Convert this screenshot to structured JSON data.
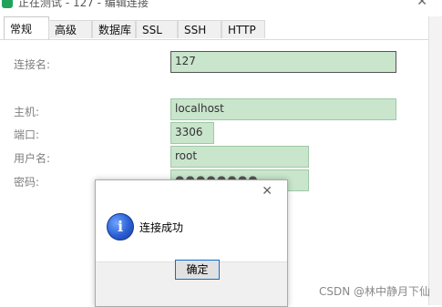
{
  "window": {
    "title": "正在测试 - 127 - 编辑连接"
  },
  "tabs": [
    {
      "label": "常规",
      "active": true
    },
    {
      "label": "高级",
      "active": false
    },
    {
      "label": "数据库",
      "active": false
    },
    {
      "label": "SSL",
      "active": false
    },
    {
      "label": "SSH",
      "active": false
    },
    {
      "label": "HTTP",
      "active": false
    }
  ],
  "form": {
    "connection_name_label": "连接名:",
    "connection_name_value": "127",
    "host_label": "主机:",
    "host_value": "localhost",
    "port_label": "端口:",
    "port_value": "3306",
    "user_label": "用户名:",
    "user_value": "root",
    "password_label": "密码:",
    "password_value": "●●●●●●●●"
  },
  "dialog": {
    "message": "连接成功",
    "ok_label": "确定",
    "close_glyph": "✕"
  },
  "watermark": "CSDN @林中静月下仙",
  "colors": {
    "field_fill": "#c9e5cc",
    "accent": "#0b6ed8"
  },
  "icons": {
    "app": "navicat-app-icon",
    "info": "info-icon"
  }
}
